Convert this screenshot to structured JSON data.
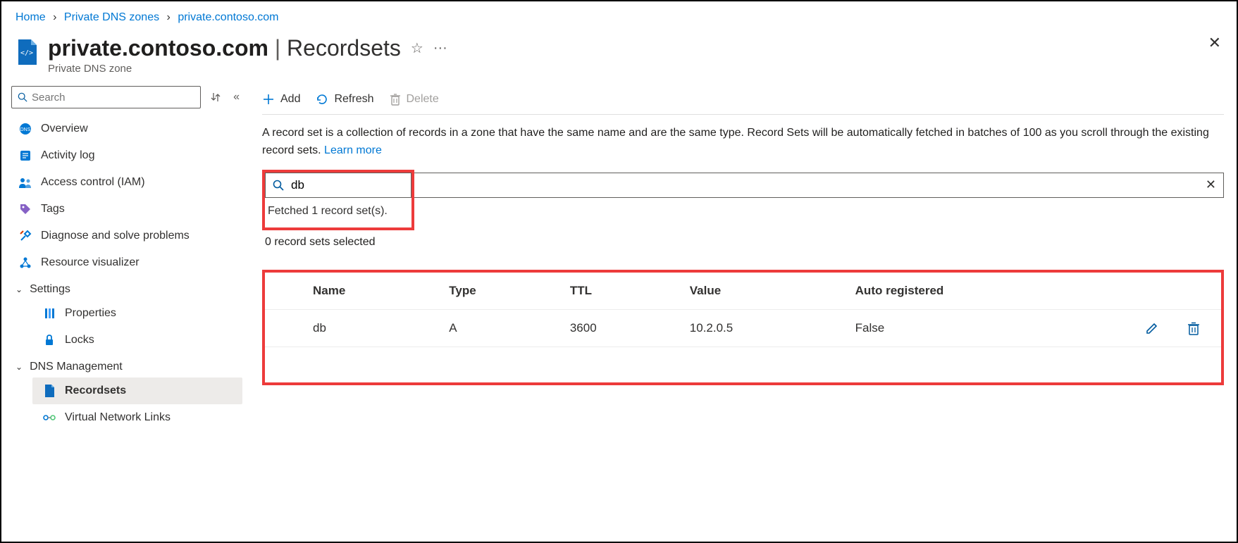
{
  "breadcrumb": {
    "items": [
      "Home",
      "Private DNS zones",
      "private.contoso.com"
    ]
  },
  "header": {
    "resource": "private.contoso.com",
    "section": "Recordsets",
    "subtitle": "Private DNS zone"
  },
  "sidebar": {
    "searchPlaceholder": "Search",
    "items": {
      "overview": "Overview",
      "activityLog": "Activity log",
      "accessControl": "Access control (IAM)",
      "tags": "Tags",
      "diagnose": "Diagnose and solve problems",
      "resourceVisualizer": "Resource visualizer"
    },
    "groups": {
      "settings": "Settings",
      "settingsItems": {
        "properties": "Properties",
        "locks": "Locks"
      },
      "dnsManagement": "DNS Management",
      "dnsItems": {
        "recordsets": "Recordsets",
        "vnetLinks": "Virtual Network Links"
      }
    }
  },
  "toolbar": {
    "add": "Add",
    "refresh": "Refresh",
    "delete": "Delete"
  },
  "description": {
    "text": "A record set is a collection of records in a zone that have the same name and are the same type. Record Sets will be automatically fetched in batches of 100 as you scroll through the existing record sets.",
    "learnMore": "Learn more"
  },
  "search": {
    "value": "db",
    "fetched": "Fetched 1 record set(s).",
    "selected": "0 record sets selected"
  },
  "table": {
    "headers": {
      "name": "Name",
      "type": "Type",
      "ttl": "TTL",
      "value": "Value",
      "autoRegistered": "Auto registered"
    },
    "rows": [
      {
        "name": "db",
        "type": "A",
        "ttl": "3600",
        "value": "10.2.0.5",
        "autoRegistered": "False"
      }
    ]
  }
}
